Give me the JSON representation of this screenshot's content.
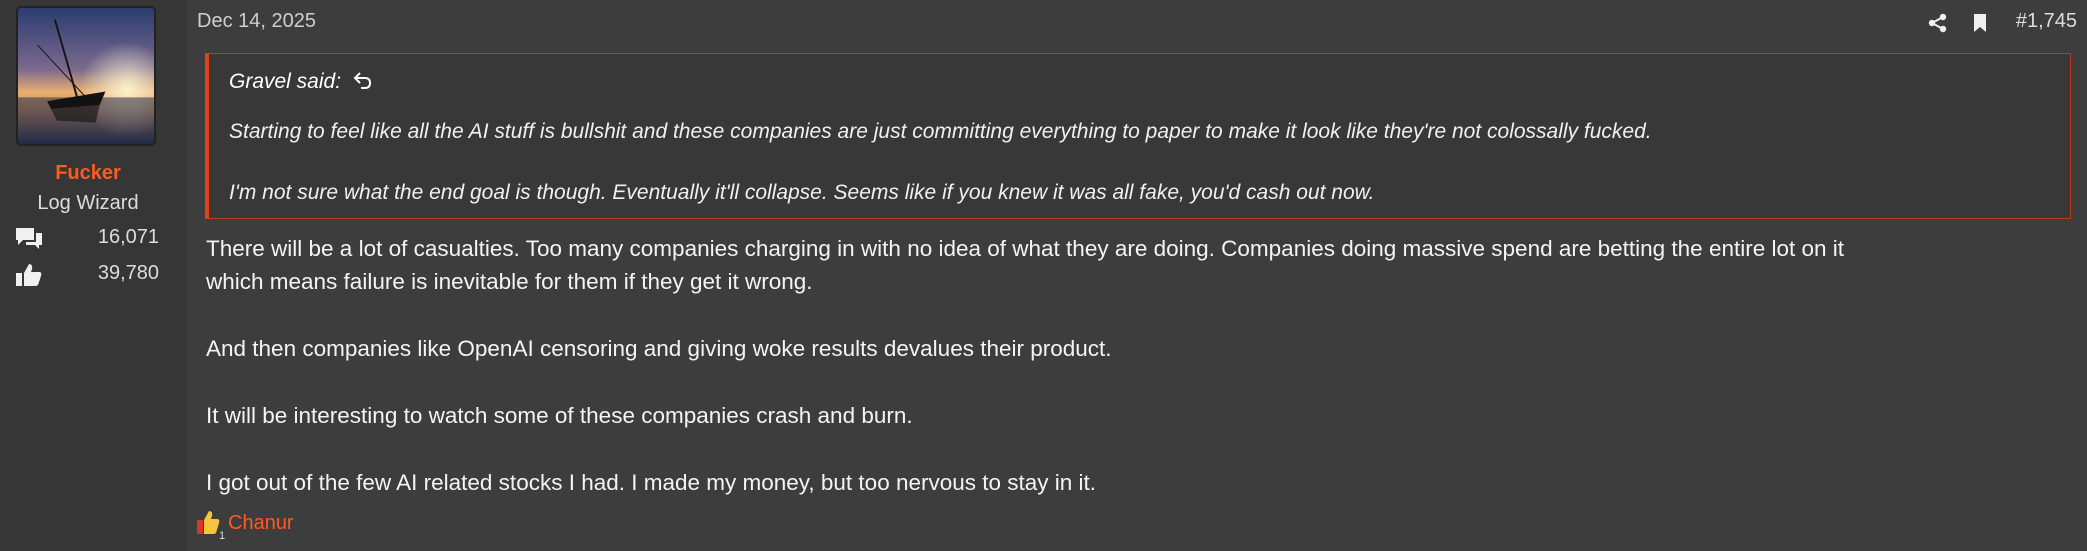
{
  "user": {
    "name": "Fucker",
    "title": "Log Wizard",
    "messages_count": "16,071",
    "reactions_count": "39,780",
    "name_color": "#ff5a1f"
  },
  "post": {
    "date": "Dec 14, 2025",
    "number": "#1,745",
    "icons": [
      "share-icon",
      "bookmark-icon"
    ]
  },
  "quote": {
    "author_line": "Gravel said:",
    "lines": [
      "Starting to feel like all the AI stuff is bullshit and these companies are just committing everything to paper to make it look like they're not colossally fucked.",
      "I'm not sure what the end goal is though. Eventually it'll collapse. Seems like if you knew it was all fake, you'd cash out now."
    ],
    "border_color": "#e0421a"
  },
  "body": {
    "lines": [
      "There will be a lot of casualties. Too many companies charging in with no idea of what they are doing. Companies doing massive spend are betting the entire lot on it",
      "which means failure is inevitable for them if they get it wrong.",
      "And then companies like OpenAI censoring and giving woke results devalues their product.",
      "It will be interesting to watch some of these companies crash and burn.",
      "I got out of the few AI related stocks I had. I made my money, but too nervous to stay in it."
    ]
  },
  "reactions": {
    "count": "1",
    "users": "Chanur",
    "icon": "like-icon"
  }
}
